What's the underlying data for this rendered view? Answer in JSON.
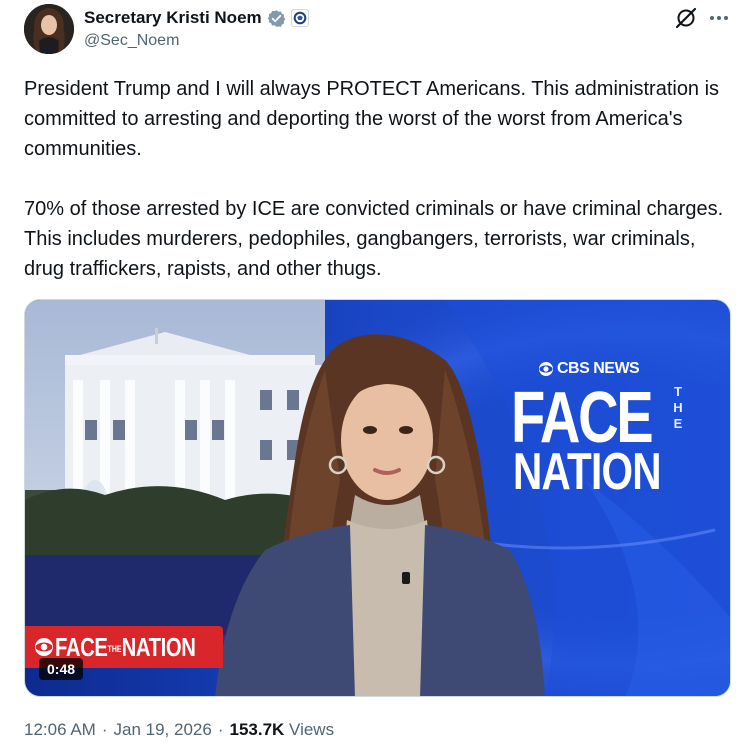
{
  "author": {
    "display_name": "Secretary Kristi Noem",
    "handle": "@Sec_Noem",
    "verified_icon": "verified-badge-icon",
    "affiliation_icon": "dhs-seal-icon"
  },
  "actions": {
    "grok_icon": "grok-icon",
    "more_icon": "more-horizontal-icon"
  },
  "post": {
    "paragraphs": [
      "President Trump and I will always PROTECT Americans. This administration is committed to arresting and deporting the worst of the worst from America's communities.",
      "70% of those arrested by ICE are convicted criminals or have criminal charges. This includes murderers, pedophiles, gangbangers, terrorists, war criminals, drug traffickers, rapists, and other thugs."
    ]
  },
  "media": {
    "type": "video",
    "duration": "0:48",
    "network_logo": "CBS NEWS",
    "show_title_line1": "FACE",
    "show_title_the": "THE",
    "show_title_line2": "NATION",
    "lower_third": "FACE",
    "lower_third_the": "THE",
    "lower_third_2": "NATION"
  },
  "meta": {
    "time": "12:06 AM",
    "date": "Jan 19, 2026",
    "views_count": "153.7K",
    "views_label": "Views",
    "separator": "·"
  },
  "colors": {
    "text_primary": "#0f1419",
    "text_secondary": "#536471",
    "verified_blue": "#1d9bf0",
    "studio_blue": "#1d49c9",
    "lower_third_red": "#d8262b"
  }
}
